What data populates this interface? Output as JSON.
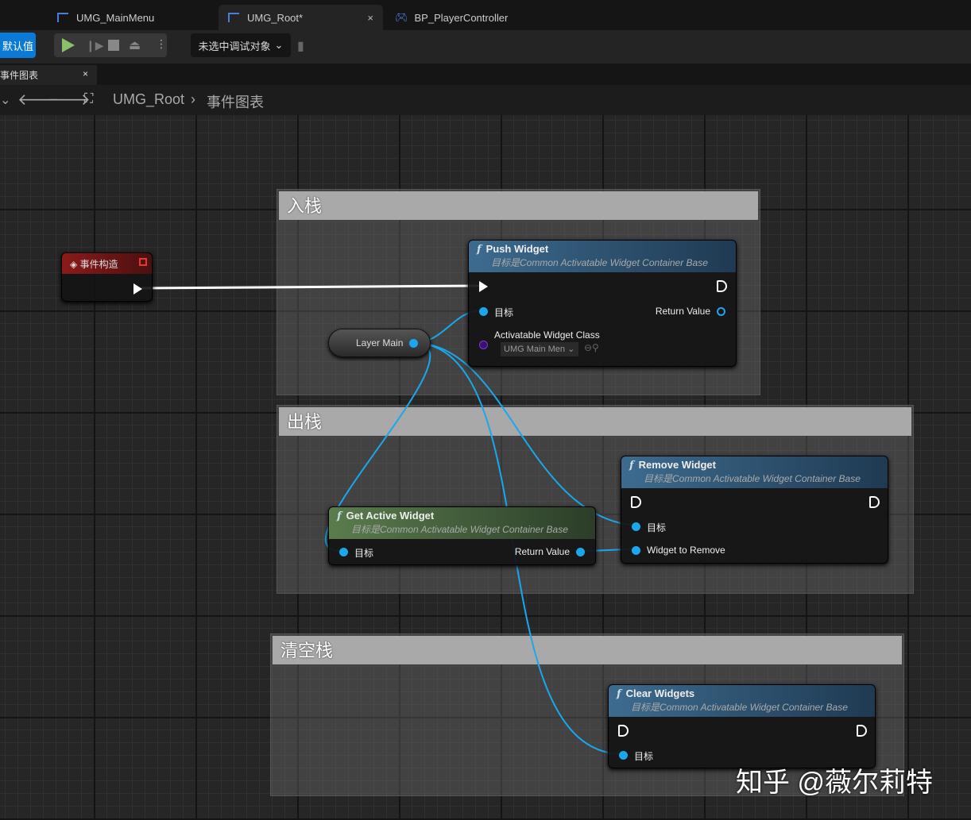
{
  "tabs": [
    {
      "label": "UMG_MainMenu"
    },
    {
      "label": "UMG_Root*",
      "active": true
    },
    {
      "label": "BP_PlayerController"
    }
  ],
  "toolbar": {
    "defaults_label": "默认值",
    "debug_select": "未选中调试对象"
  },
  "doc_tab": {
    "label": "事件图表"
  },
  "breadcrumb": {
    "root": "UMG_Root",
    "current": "事件图表"
  },
  "comments": [
    {
      "title": "入栈"
    },
    {
      "title": "出栈"
    },
    {
      "title": "清空栈"
    }
  ],
  "nodes": {
    "event": {
      "title": "事件构造"
    },
    "push": {
      "title": "Push Widget",
      "subtitle": "目标是Common Activatable Widget Container Base",
      "target": "目标",
      "return": "Return Value",
      "class_label": "Activatable Widget Class",
      "class_value": "UMG Main Men"
    },
    "layer": {
      "title": "Layer Main"
    },
    "get_active": {
      "title": "Get Active Widget",
      "subtitle": "目标是Common Activatable Widget Container Base",
      "target": "目标",
      "return": "Return Value"
    },
    "remove": {
      "title": "Remove Widget",
      "subtitle": "目标是Common Activatable Widget Container Base",
      "target": "目标",
      "widget": "Widget to Remove"
    },
    "clear": {
      "title": "Clear Widgets",
      "subtitle": "目标是Common Activatable Widget Container Base",
      "target": "目标"
    }
  },
  "watermark": "知乎 @薇尔莉特",
  "colors": {
    "object_pin": "#1aa7ec",
    "function_header": "#3d6b8f",
    "pure_header": "#5a7d4d",
    "event_header": "#8b1a1a",
    "accent": "#0a7ad6"
  }
}
